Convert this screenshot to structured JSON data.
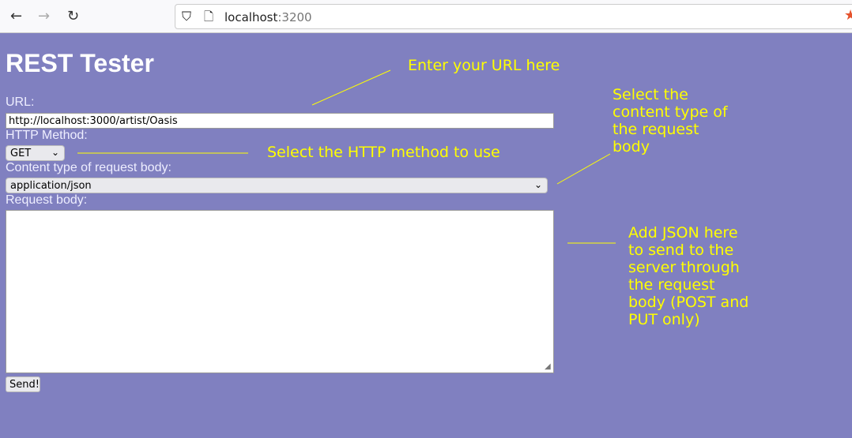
{
  "browser": {
    "url_host": "localhost",
    "url_port": ":3200",
    "icons": [
      "back-arrow-icon",
      "forward-arrow-icon",
      "reload-icon",
      "shield-icon",
      "page-icon",
      "bookmark-star-icon"
    ]
  },
  "page": {
    "title": "REST Tester",
    "url_label": "URL:",
    "url_value": "http://localhost:3000/artist/Oasis",
    "method_label": "HTTP Method:",
    "method_value": "GET",
    "content_type_label": "Content type of request body:",
    "content_type_value": "application/json",
    "body_label": "Request body:",
    "body_value": "",
    "send_label": "Send!"
  },
  "annotations": {
    "url": "Enter your URL here",
    "method": "Select the HTTP method to use",
    "content_type": [
      "Select the",
      "content type of",
      "the request",
      "body"
    ],
    "body": [
      "Add JSON here",
      "to send to the",
      "server through",
      "the request",
      "body (POST and",
      "PUT only)"
    ]
  },
  "colors": {
    "background": "#8080c0",
    "annotation": "#ffff00"
  }
}
